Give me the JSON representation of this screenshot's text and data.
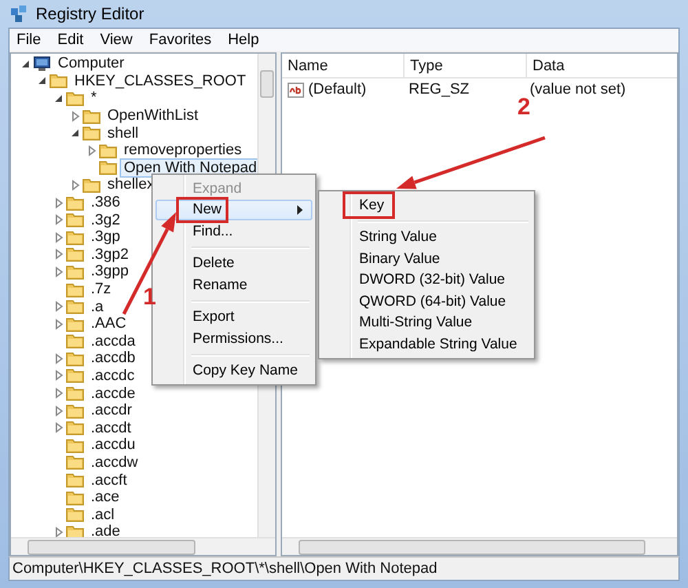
{
  "window": {
    "title": "Registry Editor"
  },
  "menu_bar": [
    "File",
    "Edit",
    "View",
    "Favorites",
    "Help"
  ],
  "tree": [
    {
      "label": "Computer",
      "kind": "computer",
      "expanded": true,
      "selected": false,
      "children": [
        {
          "label": "HKEY_CLASSES_ROOT",
          "kind": "folder",
          "expanded": true,
          "selected": false,
          "children": [
            {
              "label": "*",
              "kind": "folder",
              "expanded": true,
              "selected": false,
              "children": [
                {
                  "label": "OpenWithList",
                  "kind": "folder",
                  "expanded": false,
                  "selected": false
                },
                {
                  "label": "shell",
                  "kind": "folder",
                  "expanded": true,
                  "selected": false,
                  "children": [
                    {
                      "label": "removeproperties",
                      "kind": "folder",
                      "expanded": false,
                      "selected": false
                    },
                    {
                      "label": "Open With Notepad",
                      "kind": "leaf",
                      "selected": true
                    }
                  ]
                },
                {
                  "label": "shellex",
                  "kind": "folder",
                  "expanded": false,
                  "selected": false
                }
              ]
            },
            {
              "label": ".386",
              "kind": "folder",
              "expanded": false,
              "selected": false
            },
            {
              "label": ".3g2",
              "kind": "folder",
              "expanded": false,
              "selected": false
            },
            {
              "label": ".3gp",
              "kind": "folder",
              "expanded": false,
              "selected": false
            },
            {
              "label": ".3gp2",
              "kind": "folder",
              "expanded": false,
              "selected": false
            },
            {
              "label": ".3gpp",
              "kind": "folder",
              "expanded": false,
              "selected": false
            },
            {
              "label": ".7z",
              "kind": "leaf",
              "selected": false
            },
            {
              "label": ".a",
              "kind": "folder",
              "expanded": false,
              "selected": false
            },
            {
              "label": ".AAC",
              "kind": "folder",
              "expanded": false,
              "selected": false
            },
            {
              "label": ".accda",
              "kind": "leaf",
              "selected": false
            },
            {
              "label": ".accdb",
              "kind": "folder",
              "expanded": false,
              "selected": false
            },
            {
              "label": ".accdc",
              "kind": "folder",
              "expanded": false,
              "selected": false
            },
            {
              "label": ".accde",
              "kind": "folder",
              "expanded": false,
              "selected": false
            },
            {
              "label": ".accdr",
              "kind": "folder",
              "expanded": false,
              "selected": false
            },
            {
              "label": ".accdt",
              "kind": "folder",
              "expanded": false,
              "selected": false
            },
            {
              "label": ".accdu",
              "kind": "leaf",
              "selected": false
            },
            {
              "label": ".accdw",
              "kind": "leaf",
              "selected": false
            },
            {
              "label": ".accft",
              "kind": "leaf",
              "selected": false
            },
            {
              "label": ".ace",
              "kind": "leaf",
              "selected": false
            },
            {
              "label": ".acl",
              "kind": "leaf",
              "selected": false
            },
            {
              "label": ".ade",
              "kind": "folder",
              "expanded": false,
              "selected": false
            }
          ]
        }
      ]
    }
  ],
  "values_table": {
    "columns": [
      "Name",
      "Type",
      "Data"
    ],
    "rows": [
      {
        "name": "(Default)",
        "type": "REG_SZ",
        "data": "(value not set)"
      }
    ]
  },
  "context_menu": {
    "items": [
      {
        "kind": "item",
        "label": "Expand",
        "disabled": true,
        "selected": false,
        "submenu": false,
        "annotated": false
      },
      {
        "kind": "item",
        "label": "New",
        "disabled": false,
        "selected": true,
        "submenu": true,
        "annotated": true
      },
      {
        "kind": "item",
        "label": "Find...",
        "disabled": false,
        "selected": false,
        "submenu": false,
        "annotated": false
      },
      {
        "kind": "separator"
      },
      {
        "kind": "item",
        "label": "Delete",
        "disabled": false,
        "selected": false,
        "submenu": false,
        "annotated": false
      },
      {
        "kind": "item",
        "label": "Rename",
        "disabled": false,
        "selected": false,
        "submenu": false,
        "annotated": false
      },
      {
        "kind": "separator"
      },
      {
        "kind": "item",
        "label": "Export",
        "disabled": false,
        "selected": false,
        "submenu": false,
        "annotated": false
      },
      {
        "kind": "item",
        "label": "Permissions...",
        "disabled": false,
        "selected": false,
        "submenu": false,
        "annotated": false
      },
      {
        "kind": "separator"
      },
      {
        "kind": "item",
        "label": "Copy Key Name",
        "disabled": false,
        "selected": false,
        "submenu": false,
        "annotated": false
      }
    ]
  },
  "submenu": {
    "items": [
      {
        "kind": "item",
        "label": "Key",
        "disabled": false,
        "selected": false,
        "submenu": false,
        "annotated": true
      },
      {
        "kind": "separator"
      },
      {
        "kind": "item",
        "label": "String Value",
        "disabled": false,
        "selected": false,
        "submenu": false,
        "annotated": false
      },
      {
        "kind": "item",
        "label": "Binary Value",
        "disabled": false,
        "selected": false,
        "submenu": false,
        "annotated": false
      },
      {
        "kind": "item",
        "label": "DWORD (32-bit) Value",
        "disabled": false,
        "selected": false,
        "submenu": false,
        "annotated": false
      },
      {
        "kind": "item",
        "label": "QWORD (64-bit) Value",
        "disabled": false,
        "selected": false,
        "submenu": false,
        "annotated": false
      },
      {
        "kind": "item",
        "label": "Multi-String Value",
        "disabled": false,
        "selected": false,
        "submenu": false,
        "annotated": false
      },
      {
        "kind": "item",
        "label": "Expandable String Value",
        "disabled": false,
        "selected": false,
        "submenu": false,
        "annotated": false
      }
    ]
  },
  "annotations": [
    {
      "label": "1"
    },
    {
      "label": "2"
    }
  ],
  "status_bar": "Computer\\HKEY_CLASSES_ROOT\\*\\shell\\Open With Notepad"
}
